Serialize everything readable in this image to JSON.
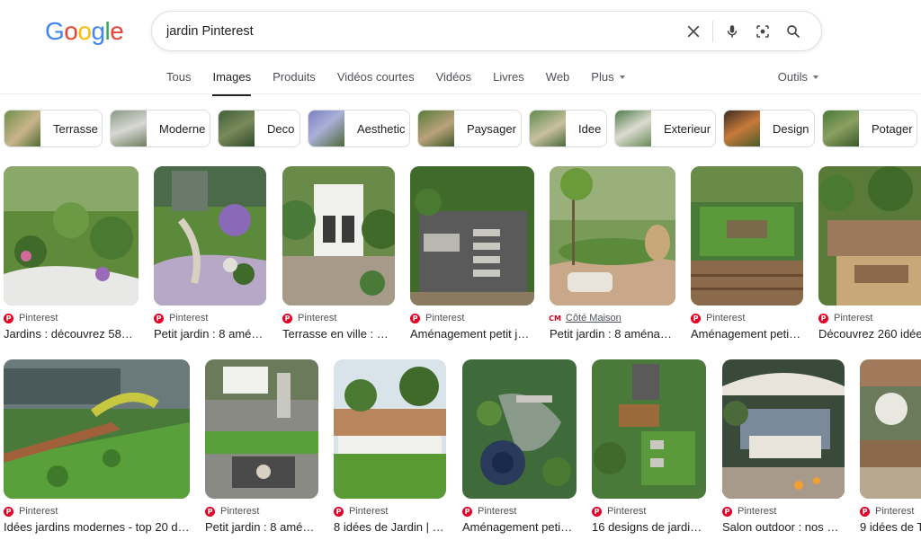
{
  "header": {
    "logo_letters": [
      "G",
      "o",
      "o",
      "g",
      "l",
      "e"
    ],
    "logo_colors": [
      "#4285f4",
      "#ea4335",
      "#fbbc05",
      "#4285f4",
      "#34a853",
      "#ea4335"
    ],
    "search_query": "jardin Pinterest",
    "icons": [
      "clear-icon",
      "microphone-icon",
      "lens-icon",
      "search-icon"
    ]
  },
  "tabs": {
    "items": [
      "Tous",
      "Images",
      "Produits",
      "Vidéos courtes",
      "Vidéos",
      "Livres",
      "Web",
      "Plus"
    ],
    "active": "Images",
    "tools": "Outils"
  },
  "chips": [
    "Terrasse",
    "Moderne",
    "Deco",
    "Aesthetic",
    "Paysager",
    "Idee",
    "Exterieur",
    "Design",
    "Potager"
  ],
  "results": {
    "row1": [
      {
        "source": "Pinterest",
        "title": "Jardins : découvrez 58…"
      },
      {
        "source": "Pinterest",
        "title": "Petit jardin : 8 amé…"
      },
      {
        "source": "Pinterest",
        "title": "Terrasse en ville : …"
      },
      {
        "source": "Pinterest",
        "title": "Aménagement petit j…"
      },
      {
        "source": "Côté Maison",
        "title": "Petit jardin : 8 aména…"
      },
      {
        "source": "Pinterest",
        "title": "Aménagement peti…"
      },
      {
        "source": "Pinterest",
        "title": "Découvrez 260 idée"
      }
    ],
    "row2": [
      {
        "source": "Pinterest",
        "title": "Idées jardins modernes - top 20 d…"
      },
      {
        "source": "Pinterest",
        "title": "Petit jardin : 8 amé…"
      },
      {
        "source": "Pinterest",
        "title": "8 idées de Jardin | …"
      },
      {
        "source": "Pinterest",
        "title": "Aménagement peti…"
      },
      {
        "source": "Pinterest",
        "title": "16 designs de jardi…"
      },
      {
        "source": "Pinterest",
        "title": "Salon outdoor : nos …"
      },
      {
        "source": "Pinterest",
        "title": "9 idées de T"
      }
    ]
  },
  "colors": {
    "pinterest_red": "#e60023",
    "text_primary": "#202124",
    "text_secondary": "#4d5156"
  }
}
